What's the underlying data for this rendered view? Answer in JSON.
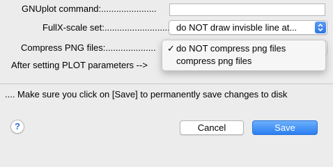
{
  "fields": {
    "gnuplot_command": {
      "label": "GNUplot command:......................",
      "value": ""
    },
    "fullx_scale": {
      "label": "FullX-scale set:...........................",
      "selected": "do NOT draw invisble line at..."
    },
    "compress_png": {
      "label": "Compress PNG files:....................",
      "options": [
        {
          "label": "do NOT compress png files",
          "checked": true
        },
        {
          "label": "compress png files",
          "checked": false
        }
      ]
    },
    "after_setting": {
      "label": "After setting PLOT parameters -->"
    }
  },
  "note": "....  Make sure you click on [Save] to permanently save changes to disk",
  "buttons": {
    "help": "?",
    "cancel": "Cancel",
    "save": "Save"
  },
  "icons": {
    "check": "✓",
    "popup_arrows": "up-down-chevron-icon"
  },
  "colors": {
    "accent": "#2b7ef1",
    "background": "#ececec"
  }
}
